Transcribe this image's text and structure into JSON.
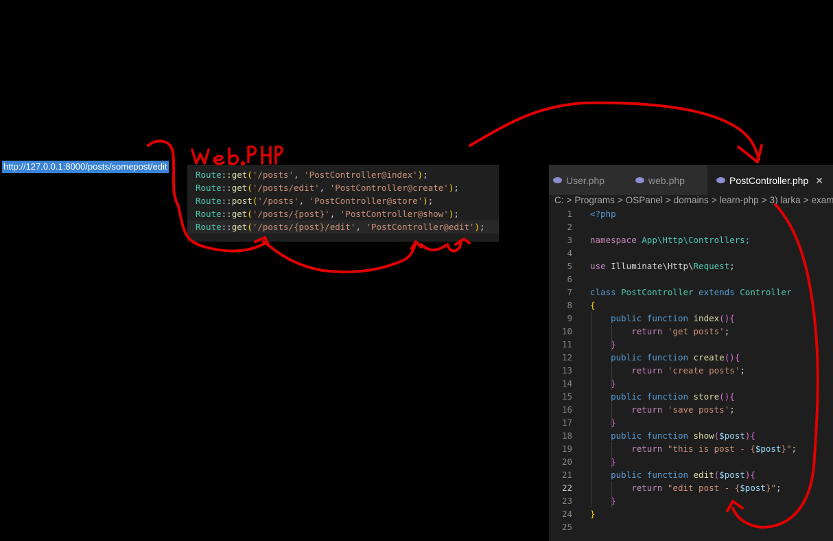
{
  "url": "http://127.0.0.1:8000/posts/somepost/edit",
  "handwritten_label": "web.php",
  "routes": [
    {
      "method": "get",
      "path": "'/posts'",
      "action": "'PostController@index'"
    },
    {
      "method": "get",
      "path": "'/posts/edit'",
      "action": "'PostController@create'"
    },
    {
      "method": "post",
      "path": "'/posts'",
      "action": "'PostController@store'"
    },
    {
      "method": "get",
      "path": "'/posts/{post}'",
      "action": "'PostController@show'"
    },
    {
      "method": "get",
      "path": "'/posts/{post}/edit'",
      "action": "'PostController@edit'"
    }
  ],
  "route_class": "Route",
  "route_sep": "::",
  "tabs": [
    {
      "label": "User.php",
      "active": false
    },
    {
      "label": "web.php",
      "active": false
    },
    {
      "label": "PostController.php",
      "active": true
    }
  ],
  "breadcrumb": [
    "C:",
    "Programs",
    "OSPanel",
    "domains",
    "learn-php",
    "3) larka",
    "example"
  ],
  "line_numbers": [
    "1",
    "2",
    "3",
    "4",
    "5",
    "6",
    "7",
    "8",
    "9",
    "10",
    "11",
    "12",
    "13",
    "14",
    "15",
    "16",
    "17",
    "18",
    "19",
    "20",
    "21",
    "22",
    "23",
    "24",
    "25"
  ],
  "current_line": "22",
  "code": {
    "php_open": "<?php",
    "namespace_kw": "namespace",
    "namespace_val": "App\\Http\\Controllers;",
    "use_kw": "use",
    "use_a": "Illuminate\\Http\\",
    "use_b": "Request",
    "class_kw": "class",
    "class_name": "PostController",
    "extends_kw": "extends",
    "parent": "Controller",
    "public": "public",
    "function": "function",
    "return": "return",
    "m_index": "index",
    "m_create": "create",
    "m_store": "store",
    "m_show": "show",
    "m_edit": "edit",
    "r_index": "'get posts'",
    "r_create": "'create posts'",
    "r_store": "'save posts'",
    "r_show_a": "\"this is post - {",
    "r_show_b": "}\"",
    "r_edit_a": "\"edit post",
    "r_edit_b": " - {",
    "r_edit_c": "}\"",
    "param": "$post"
  },
  "colors": {
    "annotation": "#e00000",
    "selection": "#3a83d6",
    "editor_bg": "#1e1e1e"
  }
}
